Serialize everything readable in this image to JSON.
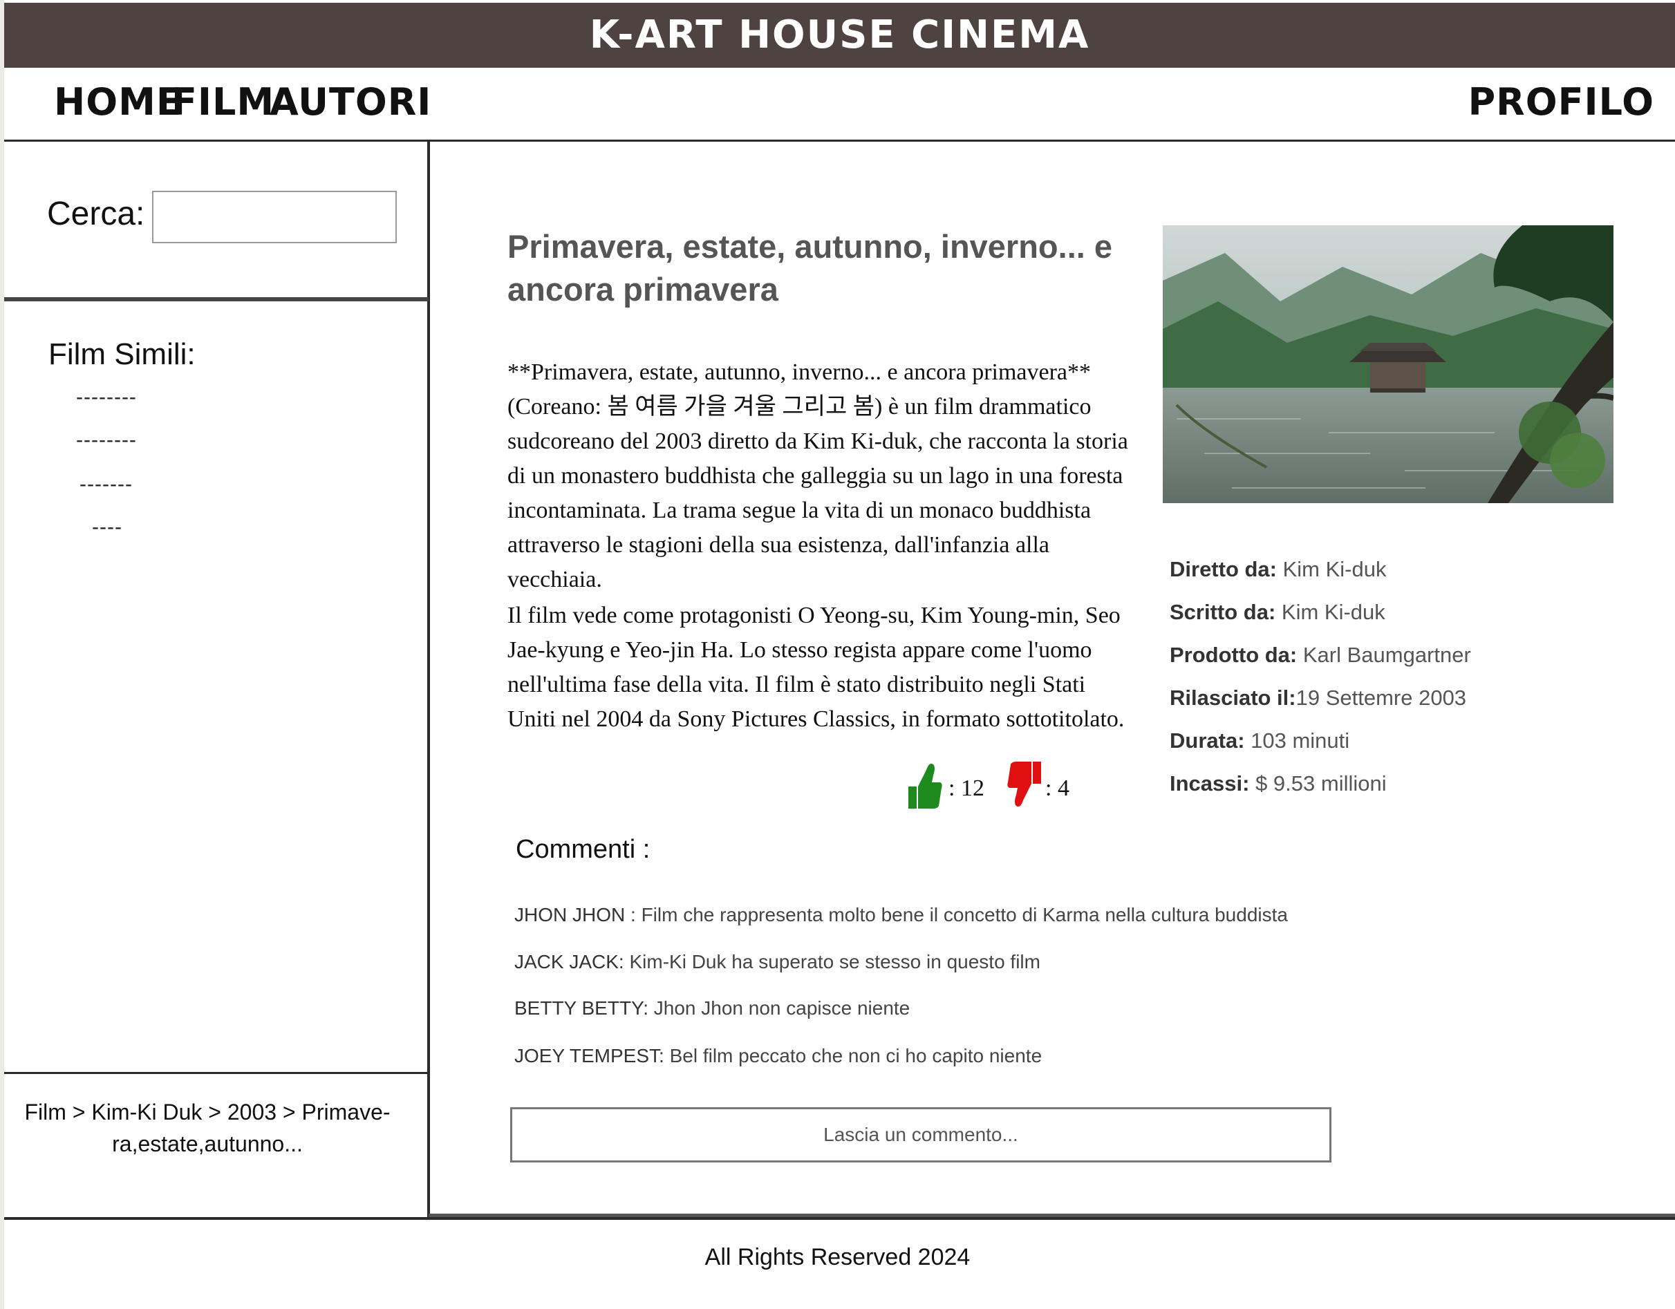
{
  "header": {
    "title": "K-ART HOUSE CINEMA"
  },
  "nav": {
    "home": "HOME",
    "film": "FILM",
    "autori": "AUTORI",
    "profilo": "PROFILO"
  },
  "sidebar": {
    "search_label": "Cerca:",
    "search_value": "",
    "similar_title": "Film Simili:",
    "similar_items": [
      "--------",
      "--------",
      "-------",
      "----"
    ],
    "breadcrumb_line1": "Film > Kim-Ki Duk > 2003 > Primave-",
    "breadcrumb_line2": "ra,estate,autunno..."
  },
  "movie": {
    "title": "Primavera, estate, autunno, inverno... e ancora primavera",
    "description_1": "**Primavera, estate, autunno, inverno... e ancora primavera** (Coreano: 봄 여름 가을 겨울 그리고 봄) è un film drammatico sudcoreano del 2003 diretto da Kim Ki-duk, che racconta la storia di un monastero buddhista che galleggia su un lago in una foresta incontaminata. La trama segue la vita di un monaco buddhista attraverso le stagioni della sua esistenza, dall'infanzia alla vecchiaia.",
    "description_2": "Il film vede come protagonisti O Yeong-su, Kim Young-min, Seo Jae-kyung e Yeo-jin Ha. Lo stesso regista appare come l'uomo nell'ultima fase della vita. Il film è stato distribuito negli Stati Uniti nel 2004 da Sony Pictures Classics, in formato sottotitolato.",
    "likes": ": 12",
    "dislikes": ": 4",
    "info": {
      "directed_label": "Diretto da:",
      "directed_value": " Kim Ki-duk",
      "written_label": "Scritto da:",
      "written_value": "  Kim Ki-duk",
      "produced_label": "Prodotto da:",
      "produced_value": " Karl Baumgartner",
      "released_label": "Rilasciato il:",
      "released_value": "19 Settemre 2003",
      "duration_label": "Durata:",
      "duration_value": " 103 minuti",
      "gross_label": "Incassi:",
      "gross_value": " $ 9.53 millioni"
    }
  },
  "comments": {
    "title": "Commenti  :",
    "items": [
      {
        "user": "JHON JHON",
        "text": " : Film che rappresenta molto bene il concetto di Karma nella cultura buddista"
      },
      {
        "user": "JACK JACK:",
        "text": "  Kim-Ki Duk ha superato se stesso in questo film"
      },
      {
        "user": "BETTY BETTY:",
        "text": "  Jhon Jhon  non capisce niente"
      },
      {
        "user": "JOEY TEMPEST:",
        "text": "  Bel film peccato che non ci ho capito niente"
      }
    ],
    "leave_placeholder": "Lascia un commento..."
  },
  "footer": {
    "text": "All Rights Reserved 2024"
  },
  "colors": {
    "header_bg": "#4e4340",
    "like": "#1e8a1e",
    "dislike": "#e01010"
  }
}
